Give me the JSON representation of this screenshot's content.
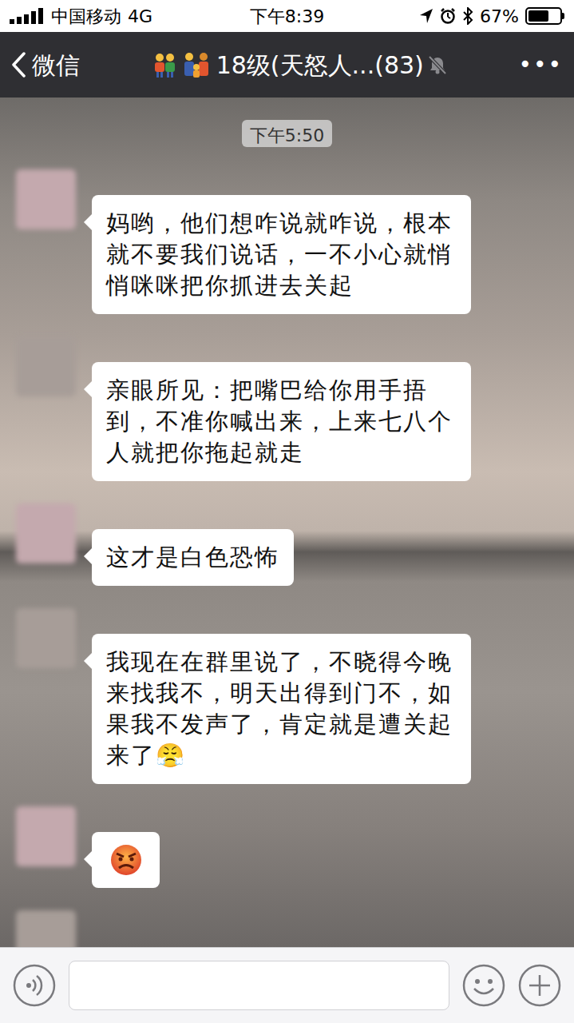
{
  "status_bar": {
    "carrier": "中国移动",
    "network": "4G",
    "time": "下午8:39",
    "battery": "67%",
    "battery_level": 0.67
  },
  "header": {
    "back": "微信",
    "title": "18级(天怒人...(83)",
    "muted": true,
    "more": "•••"
  },
  "chat": {
    "timestamp": "下午5:50",
    "messages": [
      {
        "kind": "text",
        "text": "妈哟，他们想咋说就咋说，根本就不要我们说话，一不小心就悄悄咪咪把你抓进去关起"
      },
      {
        "kind": "text",
        "text": "亲眼所见：把嘴巴给你用手捂到，不准你喊出来，上来七八个人就把你拖起就走"
      },
      {
        "kind": "text",
        "text": "这才是白色恐怖"
      },
      {
        "kind": "text",
        "text": "我现在在群里说了，不晓得今晚来找我不，明天出得到门不，如果我不发声了，肯定就是遭关起来了😤"
      },
      {
        "kind": "emoji"
      },
      {
        "kind": "partial"
      }
    ]
  }
}
